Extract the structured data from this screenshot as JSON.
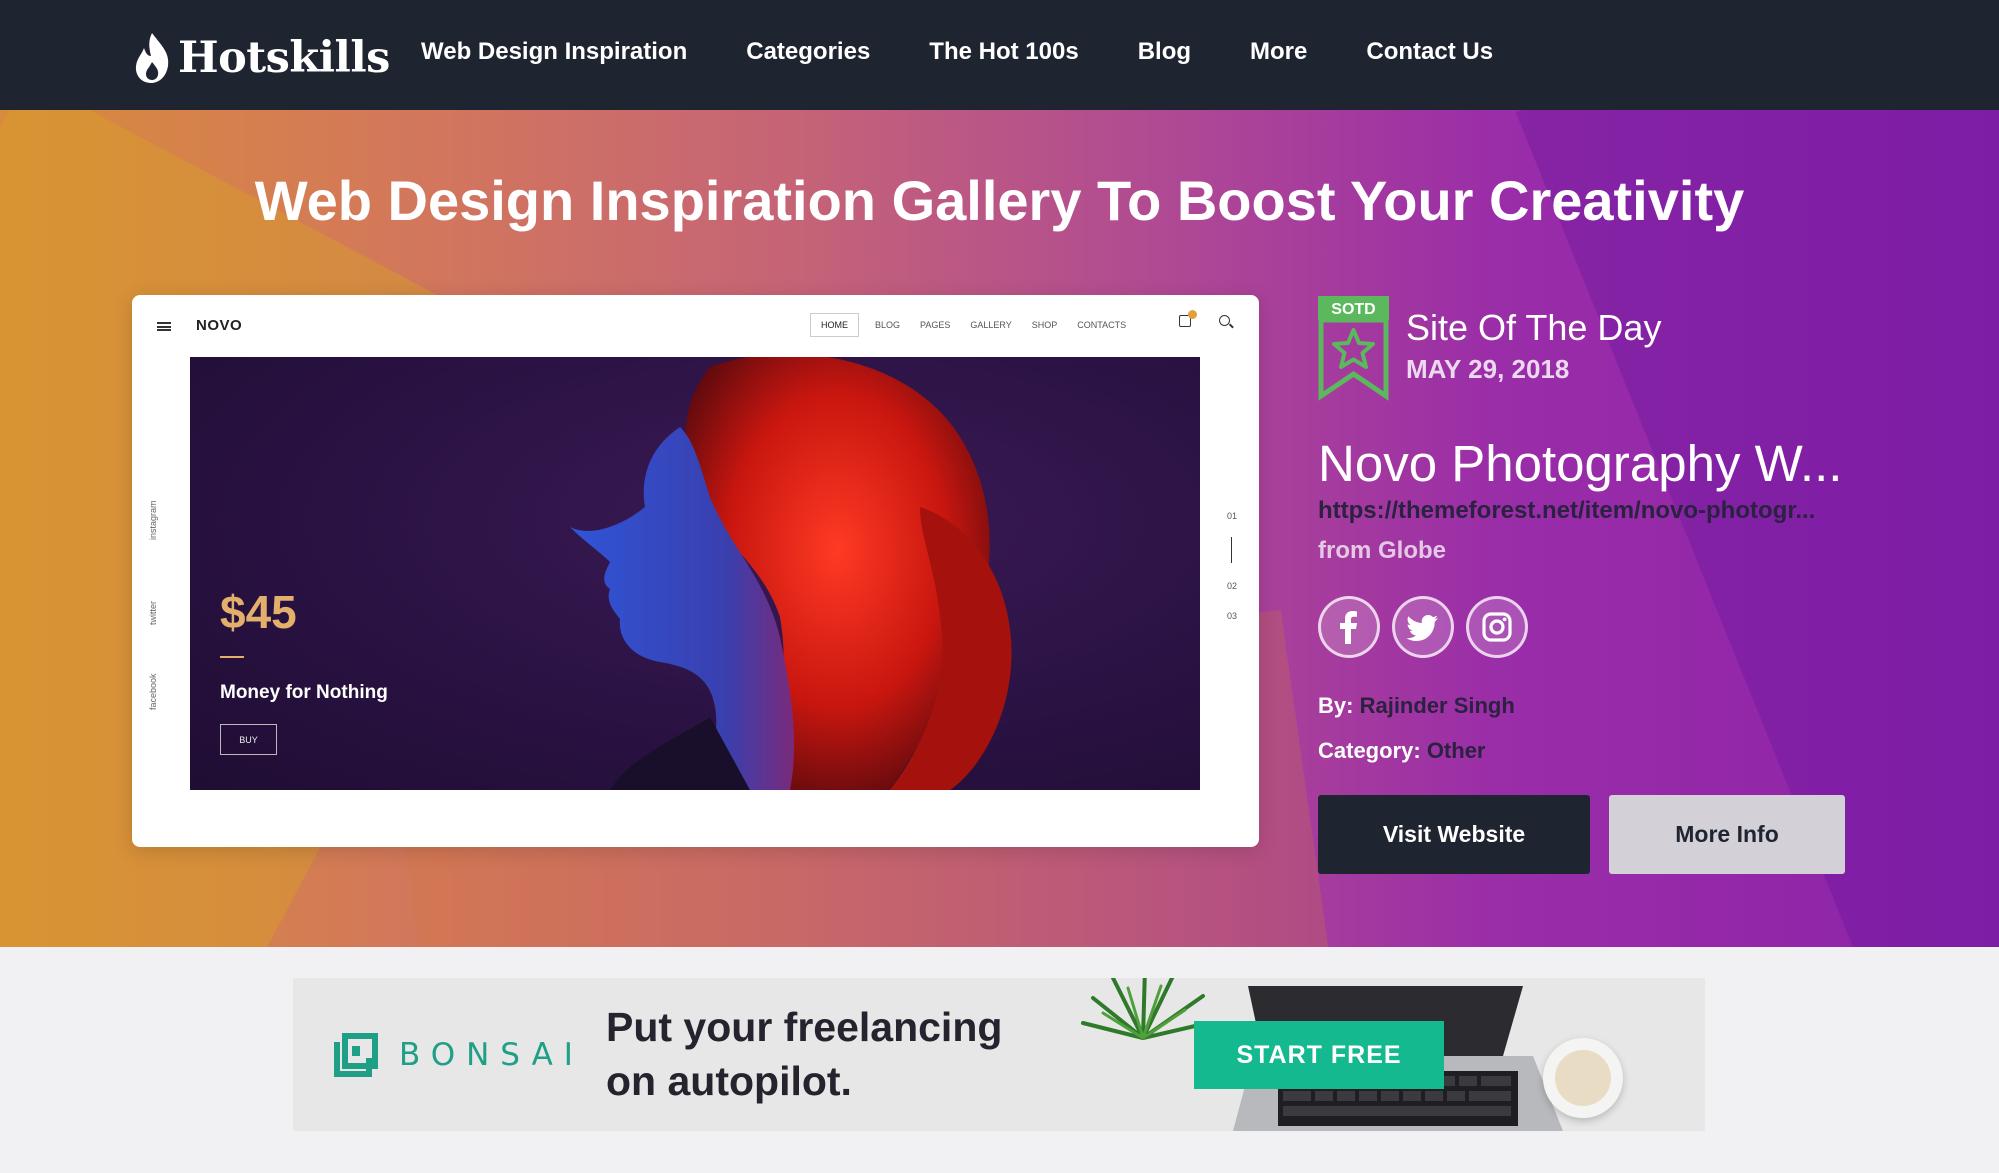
{
  "header": {
    "logo_text": "Hotskills",
    "nav": [
      "Web Design Inspiration",
      "Categories",
      "The Hot 100s",
      "Blog",
      "More",
      "Contact Us"
    ]
  },
  "hero": {
    "title": "Web Design Inspiration Gallery To Boost Your Creativity"
  },
  "preview": {
    "brand": "NOVO",
    "nav": [
      "HOME",
      "BLOG",
      "PAGES",
      "GALLERY",
      "SHOP",
      "CONTACTS"
    ],
    "side_links": [
      "instagram",
      "twitter",
      "facebook"
    ],
    "price": "$45",
    "caption": "Money for Nothing",
    "buy_label": "BUY",
    "pager": [
      "01",
      "02",
      "03"
    ]
  },
  "sotd": {
    "badge_label": "SOTD",
    "title": "Site Of The Day",
    "date": "MAY 29, 2018"
  },
  "site": {
    "name": "Novo Photography W...",
    "url": "https://themeforest.net/item/novo-photogr...",
    "from": "from Globe",
    "by_label": "By:",
    "by_value": "Rajinder Singh",
    "category_label": "Category:",
    "category_value": "Other",
    "visit_label": "Visit Website",
    "more_label": "More Info"
  },
  "socials": [
    "facebook-icon",
    "twitter-icon",
    "instagram-icon"
  ],
  "ad": {
    "brand": "BONSAI",
    "headline_line1": "Put your freelancing",
    "headline_line2": "on autopilot.",
    "cta": "START FREE"
  },
  "colors": {
    "nav_bg": "#1f2431",
    "accent_green": "#15b98f",
    "sotd_green": "#5cb85c"
  }
}
